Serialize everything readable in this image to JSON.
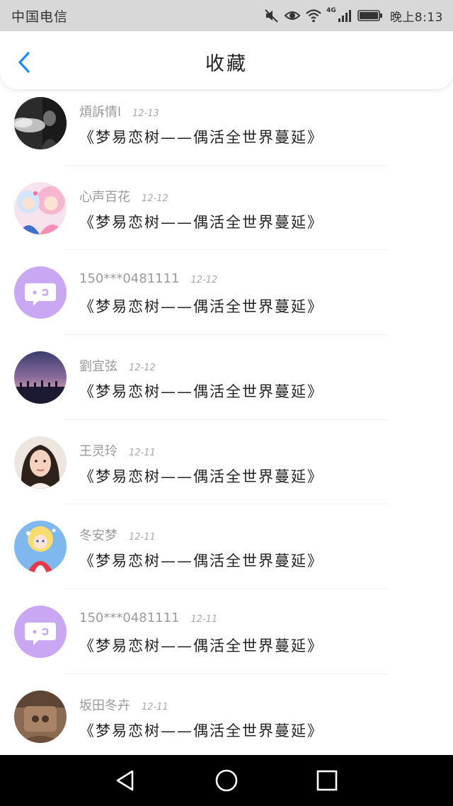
{
  "status_bar": {
    "carrier": "中国电信",
    "network": "4G",
    "time": "晚上8:13"
  },
  "header": {
    "title": "收藏",
    "back_icon": "chevron-left-icon",
    "accent_color": "#1a8cff"
  },
  "items": [
    {
      "name": "煩訴情l",
      "date": "12-13",
      "title": "《梦易恋树——偶活全世界蔓延》",
      "avatar": "avatar-smoke-photo"
    },
    {
      "name": "心声百花",
      "date": "12-12",
      "title": "《梦易恋树——偶活全世界蔓延》",
      "avatar": "avatar-anime-girls"
    },
    {
      "name": "150***0481111",
      "date": "12-12",
      "title": "《梦易恋树——偶活全世界蔓延》",
      "avatar": "default-chat-avatar-icon"
    },
    {
      "name": "劉宜弦",
      "date": "12-12",
      "title": "《梦易恋树——偶活全世界蔓延》",
      "avatar": "avatar-twilight-crowd"
    },
    {
      "name": "王灵玲",
      "date": "12-11",
      "title": "《梦易恋树——偶活全世界蔓延》",
      "avatar": "avatar-portrait-photo"
    },
    {
      "name": "冬安梦",
      "date": "12-11",
      "title": "《梦易恋树——偶活全世界蔓延》",
      "avatar": "avatar-anime-idol"
    },
    {
      "name": "150***0481111",
      "date": "12-11",
      "title": "《梦易恋树——偶活全世界蔓延》",
      "avatar": "default-chat-avatar-icon"
    },
    {
      "name": "坂田冬卉",
      "date": "12-11",
      "title": "《梦易恋树——偶活全世界蔓延》",
      "avatar": "avatar-brown-photo"
    }
  ],
  "nav_bar": {
    "back_icon": "triangle-back-icon",
    "home_icon": "circle-home-icon",
    "recents_icon": "square-recents-icon"
  }
}
